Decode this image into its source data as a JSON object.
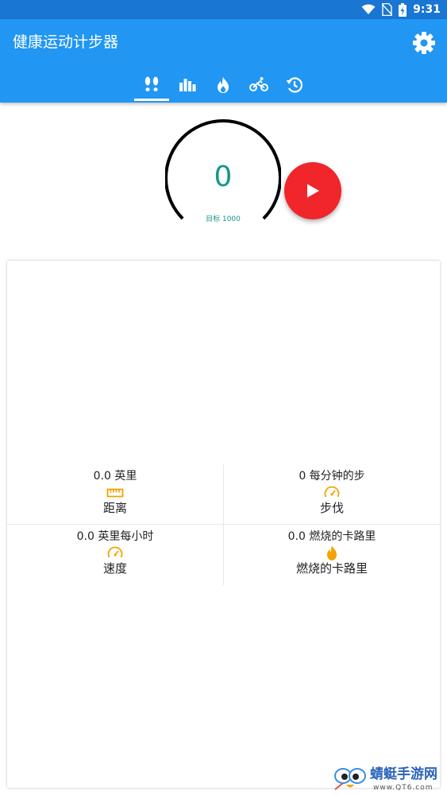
{
  "status_bar": {
    "time": "9:31",
    "icons": [
      "wifi-icon",
      "no-sim-icon",
      "battery-charging-icon"
    ]
  },
  "app_bar": {
    "title": "健康运动计步器",
    "settings_icon": "gear-icon",
    "tabs": [
      {
        "icon": "footsteps-icon",
        "active": true
      },
      {
        "icon": "bar-chart-icon",
        "active": false
      },
      {
        "icon": "flame-icon",
        "active": false
      },
      {
        "icon": "cycling-icon",
        "active": false
      },
      {
        "icon": "history-icon",
        "active": false
      }
    ]
  },
  "counter": {
    "steps": "0",
    "goal_label": "目标 1000",
    "progress": 0.0,
    "play_icon": "play-icon"
  },
  "stats": {
    "distance": {
      "value": "0.0 英里",
      "label": "距离",
      "icon": "ruler-icon"
    },
    "pace": {
      "value": "0 每分钟的步",
      "label": "步伐",
      "icon": "speedometer-icon"
    },
    "speed": {
      "value": "0.0 英里每小时",
      "label": "速度",
      "icon": "speedometer-icon"
    },
    "calories": {
      "value": "0.0 燃烧的卡路里",
      "label": "燃烧的卡路里",
      "icon": "flame-icon"
    }
  },
  "watermark": {
    "brand": "蜻蜓手游网",
    "url": "www.QT6.com"
  },
  "colors": {
    "status_bar": "#1976D2",
    "app_bar": "#2196F3",
    "accent_teal": "#16978a",
    "play_button": "#f0262a",
    "stat_icon": "#f2a400"
  }
}
